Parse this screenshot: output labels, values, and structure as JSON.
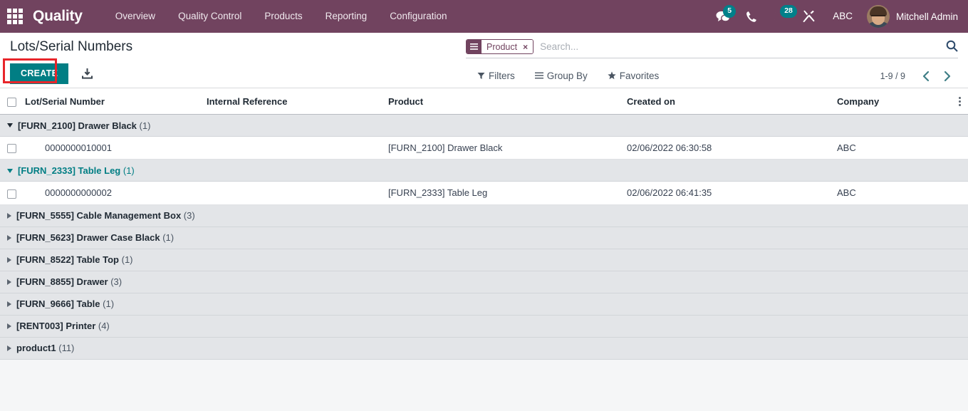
{
  "navbar": {
    "apps_icon": "apps-grid-icon",
    "brand": "Quality",
    "menu": [
      {
        "label": "Overview"
      },
      {
        "label": "Quality Control"
      },
      {
        "label": "Products"
      },
      {
        "label": "Reporting"
      },
      {
        "label": "Configuration"
      }
    ],
    "messages_icon": "messages-icon",
    "messages_count": "5",
    "phone_icon": "phone-icon",
    "activity_icon": "activity-clock-icon",
    "activity_count": "28",
    "debug_icon": "wrench-tools-icon",
    "company": "ABC",
    "user_name": "Mitchell Admin",
    "badge_color": "#00808a",
    "background_color": "#71435f"
  },
  "control_panel": {
    "title": "Lots/Serial Numbers",
    "create_label": "CREATE",
    "create_color": "#017e84",
    "highlight_color": "#e8252a",
    "import_icon": "import-download-icon",
    "search": {
      "facet_icon": "group-by-lines-icon",
      "facet_label": "Product",
      "facet_remove": "×",
      "placeholder": "Search...",
      "value": "",
      "search_icon": "search-magnifier-icon"
    },
    "tools": [
      {
        "label": "Filters",
        "icon": "filter-funnel-icon"
      },
      {
        "label": "Group By",
        "icon": "group-by-lines-icon"
      },
      {
        "label": "Favorites",
        "icon": "favorites-star-icon"
      }
    ],
    "pager": {
      "count": "1-9 / 9",
      "prev_icon": "chevron-left-icon",
      "next_icon": "chevron-right-icon"
    }
  },
  "list": {
    "columns": [
      "Lot/Serial Number",
      "Internal Reference",
      "Product",
      "Created on",
      "Company"
    ],
    "optional_columns_icon": "vertical-dots-icon",
    "groups": [
      {
        "label": "[FURN_2100] Drawer Black",
        "count": "(1)",
        "expanded": true,
        "hovered": false,
        "rows": [
          {
            "lot": "0000000010001",
            "internal_reference": "",
            "product": "[FURN_2100] Drawer Black",
            "created_on": "02/06/2022 06:30:58",
            "company": "ABC"
          }
        ]
      },
      {
        "label": "[FURN_2333] Table Leg",
        "count": "(1)",
        "expanded": true,
        "hovered": true,
        "rows": [
          {
            "lot": "0000000000002",
            "internal_reference": "",
            "product": "[FURN_2333] Table Leg",
            "created_on": "02/06/2022 06:41:35",
            "company": "ABC"
          }
        ]
      },
      {
        "label": "[FURN_5555] Cable Management Box",
        "count": "(3)",
        "expanded": false,
        "hovered": false,
        "rows": []
      },
      {
        "label": "[FURN_5623] Drawer Case Black",
        "count": "(1)",
        "expanded": false,
        "hovered": false,
        "rows": []
      },
      {
        "label": "[FURN_8522] Table Top",
        "count": "(1)",
        "expanded": false,
        "hovered": false,
        "rows": []
      },
      {
        "label": "[FURN_8855] Drawer",
        "count": "(3)",
        "expanded": false,
        "hovered": false,
        "rows": []
      },
      {
        "label": "[FURN_9666] Table",
        "count": "(1)",
        "expanded": false,
        "hovered": false,
        "rows": []
      },
      {
        "label": "[RENT003] Printer",
        "count": "(4)",
        "expanded": false,
        "hovered": false,
        "rows": []
      },
      {
        "label": "product1",
        "count": "(11)",
        "expanded": false,
        "hovered": false,
        "rows": []
      }
    ]
  }
}
